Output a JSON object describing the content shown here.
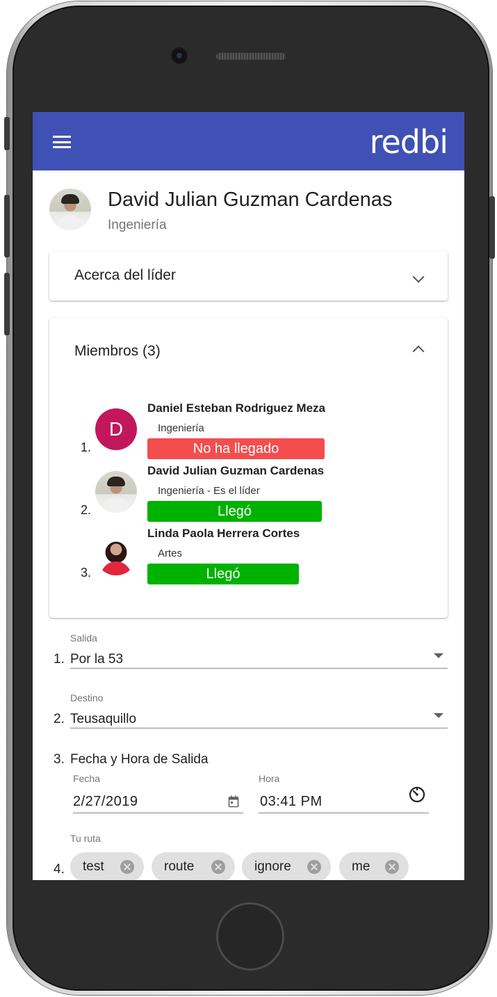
{
  "app": {
    "brand": "redbi"
  },
  "colors": {
    "appbar": "#3f51b5",
    "not_arrived": "#f44d4d",
    "arrived": "#00b200",
    "avatar_d": "#c2185b"
  },
  "leader": {
    "name": "David Julian Guzman Cardenas",
    "department": "Ingeniería"
  },
  "about_card": {
    "title": "Acerca del líder"
  },
  "members_card": {
    "title": "Miembros (3)",
    "members": [
      {
        "index": "1.",
        "avatar_letter": "D",
        "name": "Daniel Esteban Rodriguez Meza",
        "department": "Ingeniería",
        "status": "No ha llegado"
      },
      {
        "index": "2.",
        "name": "David Julian Guzman Cardenas",
        "department": "Ingeniería - Es el líder",
        "status": "Llegó"
      },
      {
        "index": "3.",
        "name": "Linda Paola Herrera Cortes",
        "department": "Artes",
        "status": "Llegó"
      }
    ]
  },
  "form": {
    "salida": {
      "num": "1.",
      "label": "Salida",
      "value": "Por la 53"
    },
    "destino": {
      "num": "2.",
      "label": "Destino",
      "value": "Teusaquillo"
    },
    "fecha_hora": {
      "num": "3.",
      "title": "Fecha y Hora de Salida",
      "date_label": "Fecha",
      "date_value": "2/27/2019",
      "time_label": "Hora",
      "time_value": "03:41 PM"
    },
    "ruta": {
      "num": "4.",
      "label": "Tu ruta",
      "chips": [
        "test",
        "route",
        "ignore",
        "me"
      ]
    }
  },
  "icons": {
    "menu": "menu-icon",
    "calendar": "calendar-icon",
    "clock": "clock-icon",
    "chip_remove": "cancel-icon"
  }
}
